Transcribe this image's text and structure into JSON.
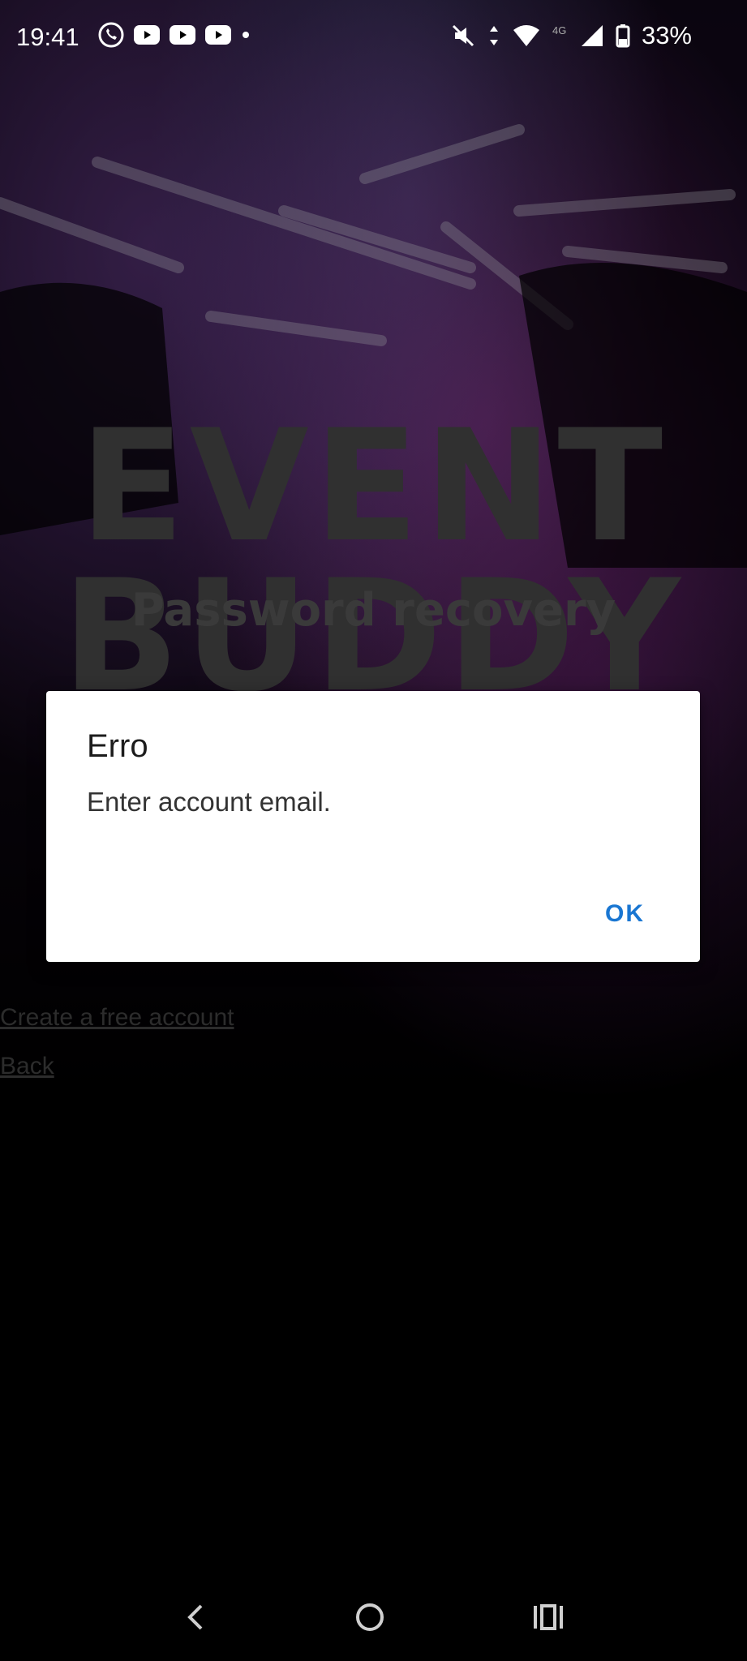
{
  "status_bar": {
    "time": "19:41",
    "battery": "33%",
    "notification_icons": [
      "whatsapp-icon",
      "youtube-icon",
      "youtube-icon",
      "youtube-icon",
      "dot-icon"
    ],
    "system_icons": [
      "mute-icon",
      "data-arrows-icon",
      "wifi-icon",
      "network-4g-icon",
      "signal-icon",
      "battery-icon"
    ]
  },
  "background": {
    "logo_line1": "EVENT",
    "logo_line2": "BUDDY",
    "title": "Password recovery",
    "create_account_link": "Create a free account",
    "back_link": "Back"
  },
  "dialog": {
    "title": "Erro",
    "message": "Enter account email.",
    "ok_label": "OK",
    "accent_color": "#1976d2"
  },
  "nav_bar": {
    "buttons": [
      "back-icon",
      "home-icon",
      "recents-icon"
    ]
  }
}
